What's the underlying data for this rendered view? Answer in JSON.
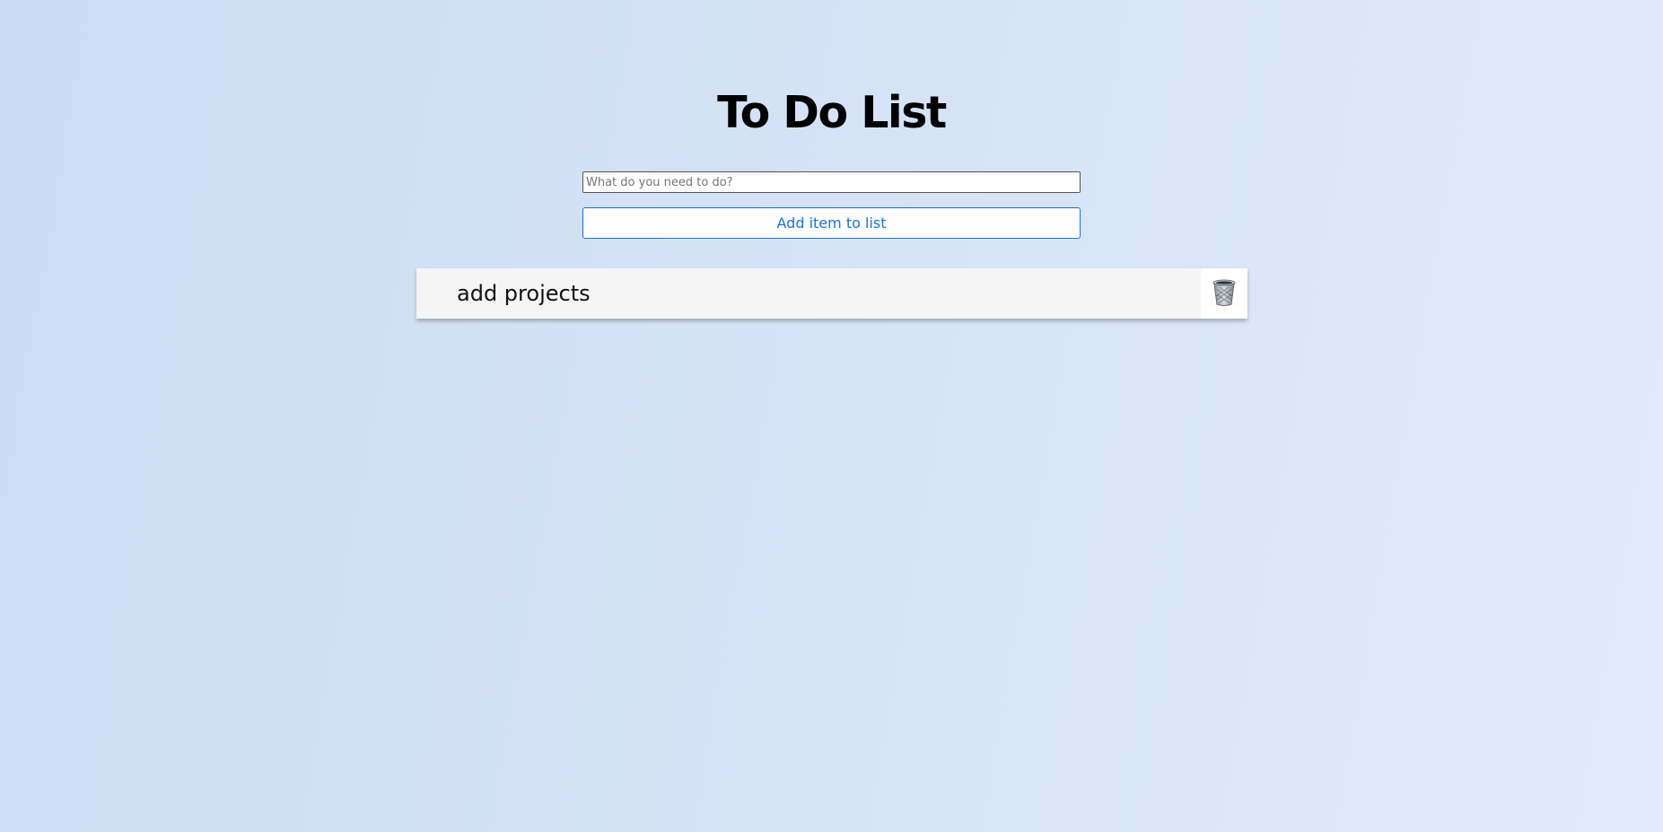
{
  "header": {
    "title": "To Do List"
  },
  "form": {
    "input_value": "",
    "input_placeholder": "What do you need to do?",
    "add_button_label": "Add item to list"
  },
  "list": {
    "items": [
      {
        "text": "add projects",
        "action_icon": "trash-icon"
      }
    ]
  },
  "colors": {
    "accent": "#1a6fe6",
    "item_background": "#f5f5f5"
  }
}
